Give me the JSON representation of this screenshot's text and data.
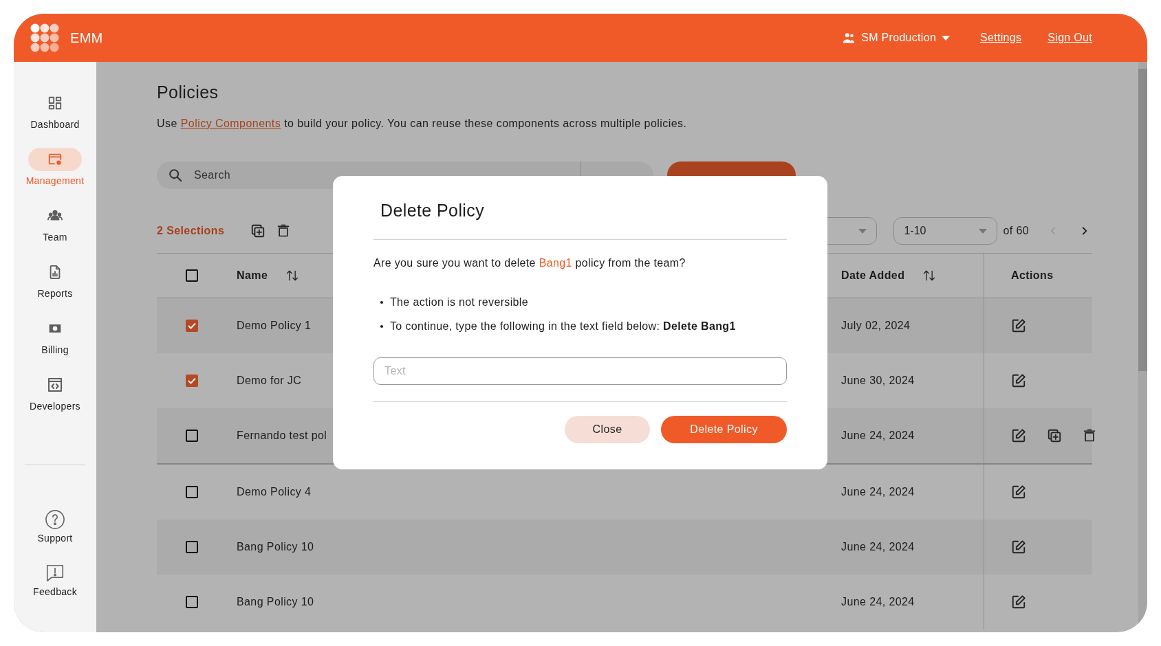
{
  "header": {
    "brand": "EMM",
    "workspace": "SM Production",
    "links": [
      "Settings",
      "Sign Out"
    ]
  },
  "sidebar": {
    "items": [
      {
        "label": "Dashboard",
        "selected": false
      },
      {
        "label": "Management",
        "selected": true
      },
      {
        "label": "Team",
        "selected": false
      },
      {
        "label": "Reports",
        "selected": false
      },
      {
        "label": "Billing",
        "selected": false
      },
      {
        "label": "Developers",
        "selected": false
      }
    ],
    "bottom_items": [
      {
        "label": "Support"
      },
      {
        "label": "Feedback"
      }
    ]
  },
  "page": {
    "title": "Policies",
    "description": {
      "prefix": "Use",
      "link": "Policy Components",
      "suffix": "to build your policy. You can reuse these components across multiple policies."
    }
  },
  "toolbar": {
    "search_placeholder": "Search"
  },
  "selection": {
    "count_label": "2 Selections"
  },
  "pagination": {
    "page_size": "1-10",
    "total": "of 60",
    "prev_disabled": true
  },
  "table": {
    "columns": [
      "Name",
      "Date Added",
      "Actions"
    ],
    "all_checked": false,
    "rows": [
      {
        "name": "Demo Policy 1",
        "date": "July 02, 2024",
        "checked": true,
        "hovered": false
      },
      {
        "name": "Demo for JC",
        "date": "June 30, 2024",
        "checked": true,
        "hovered": false
      },
      {
        "name": "Fernando test pol",
        "date": "June 24, 2024",
        "checked": false,
        "hovered": true
      },
      {
        "name": "Demo Policy 4",
        "date": "June 24, 2024",
        "checked": false,
        "hovered": false
      },
      {
        "name": "Bang Policy 10",
        "date": "June 24, 2024",
        "checked": false,
        "hovered": false
      },
      {
        "name": "Bang Policy 10",
        "date": "June 24, 2024",
        "checked": false,
        "hovered": false
      }
    ]
  },
  "dialog": {
    "title": "Delete Policy",
    "question": {
      "prefix": "Are you sure you want to delete",
      "policy": "Bang1",
      "suffix": "policy from the team?"
    },
    "bullets": [
      "The action is not reversible",
      "To continue, type the following in the text field below: **Delete Bang1**"
    ],
    "input_placeholder": "Text",
    "cancel_button": "Close",
    "confirm_button": "Delete Policy"
  }
}
